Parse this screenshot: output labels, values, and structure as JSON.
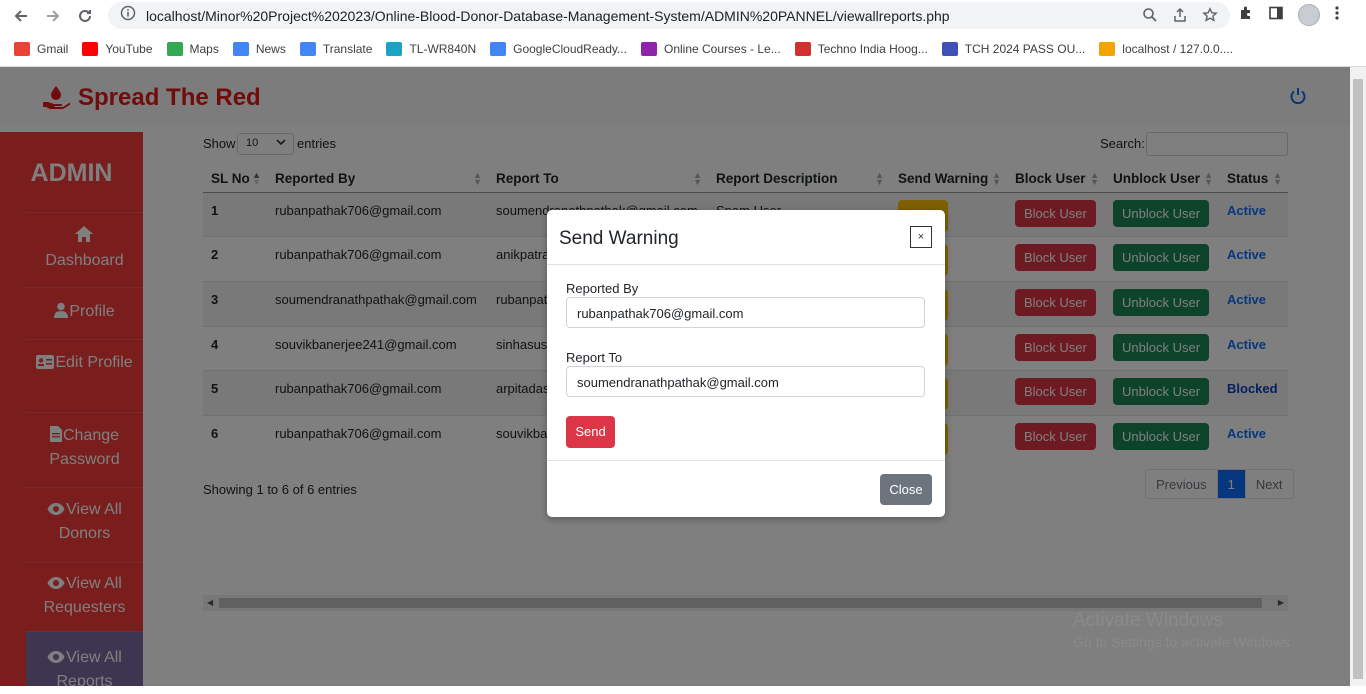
{
  "browser": {
    "url": "localhost/Minor%20Project%202023/Online-Blood-Donor-Database-Management-System/ADMIN%20PANNEL/viewallreports.php",
    "bookmarks": [
      {
        "label": "Gmail",
        "color": "#ea4335"
      },
      {
        "label": "YouTube",
        "color": "#ff0000"
      },
      {
        "label": "Maps",
        "color": "#34a853"
      },
      {
        "label": "News",
        "color": "#4285f4"
      },
      {
        "label": "Translate",
        "color": "#4285f4"
      },
      {
        "label": "TL-WR840N",
        "color": "#1aa3c4"
      },
      {
        "label": "GoogleCloudReady...",
        "color": "#4285f4"
      },
      {
        "label": "Online Courses - Le...",
        "color": "#8e24aa"
      },
      {
        "label": "Techno India Hoog...",
        "color": "#d32f2f"
      },
      {
        "label": "TCH 2024 PASS OU...",
        "color": "#3f51b5"
      },
      {
        "label": "localhost / 127.0.0....",
        "color": "#f4a400"
      }
    ]
  },
  "app": {
    "brand": "Spread The Red",
    "brand_color": "#e01818"
  },
  "sidebar": {
    "title": "ADMIN",
    "items": [
      {
        "label": "Dashboard",
        "icon": "home-icon"
      },
      {
        "label": "Profile",
        "icon": "user-icon"
      },
      {
        "label": "Edit Profile",
        "icon": "id-card-icon"
      },
      {
        "label": "Change Password",
        "icon": "file-icon"
      },
      {
        "label": "View All Donors",
        "icon": "eye-icon"
      },
      {
        "label": "View All Requesters",
        "icon": "eye-icon"
      },
      {
        "label": "View All Reports",
        "icon": "eye-icon"
      }
    ]
  },
  "table_controls": {
    "show_label": "Show",
    "page_size": "10",
    "entries_label": "entries",
    "search_label": "Search:"
  },
  "table": {
    "headers": [
      "SL No",
      "Reported By",
      "Report To",
      "Report Description",
      "Send Warning",
      "Block User",
      "Unblock User",
      "Status"
    ],
    "rows": [
      {
        "sl": "1",
        "by": "rubanpathak706@gmail.com",
        "to": "soumendranathpathak@gmail.com",
        "desc": "Spam User",
        "status": "Active"
      },
      {
        "sl": "2",
        "by": "rubanpathak706@gmail.com",
        "to": "anikpatra",
        "desc": "",
        "status": "Active"
      },
      {
        "sl": "3",
        "by": "soumendranathpathak@gmail.com",
        "to": "rubanpat",
        "desc": "",
        "status": "Active"
      },
      {
        "sl": "4",
        "by": "souvikbanerjee241@gmail.com",
        "to": "sinhasusr",
        "desc": "",
        "status": "Active"
      },
      {
        "sl": "5",
        "by": "rubanpathak706@gmail.com",
        "to": "arpitadas",
        "desc": "",
        "status": "Blocked"
      },
      {
        "sl": "6",
        "by": "rubanpathak706@gmail.com",
        "to": "souvikba",
        "desc": "",
        "status": "Active"
      }
    ],
    "block_label": "Block User",
    "unblock_label": "Unblock User"
  },
  "footer": {
    "info": "Showing 1 to 6 of 6 entries",
    "prev": "Previous",
    "page": "1",
    "next": "Next"
  },
  "modal": {
    "title": "Send Warning",
    "close_x": "×",
    "reported_by_label": "Reported By",
    "reported_by_value": "rubanpathak706@gmail.com",
    "report_to_label": "Report To",
    "report_to_value": "soumendranathpathak@gmail.com",
    "send_label": "Send",
    "close_label": "Close"
  },
  "watermark": {
    "line1": "Activate Windows",
    "line2": "Go to Settings to activate Windows."
  }
}
